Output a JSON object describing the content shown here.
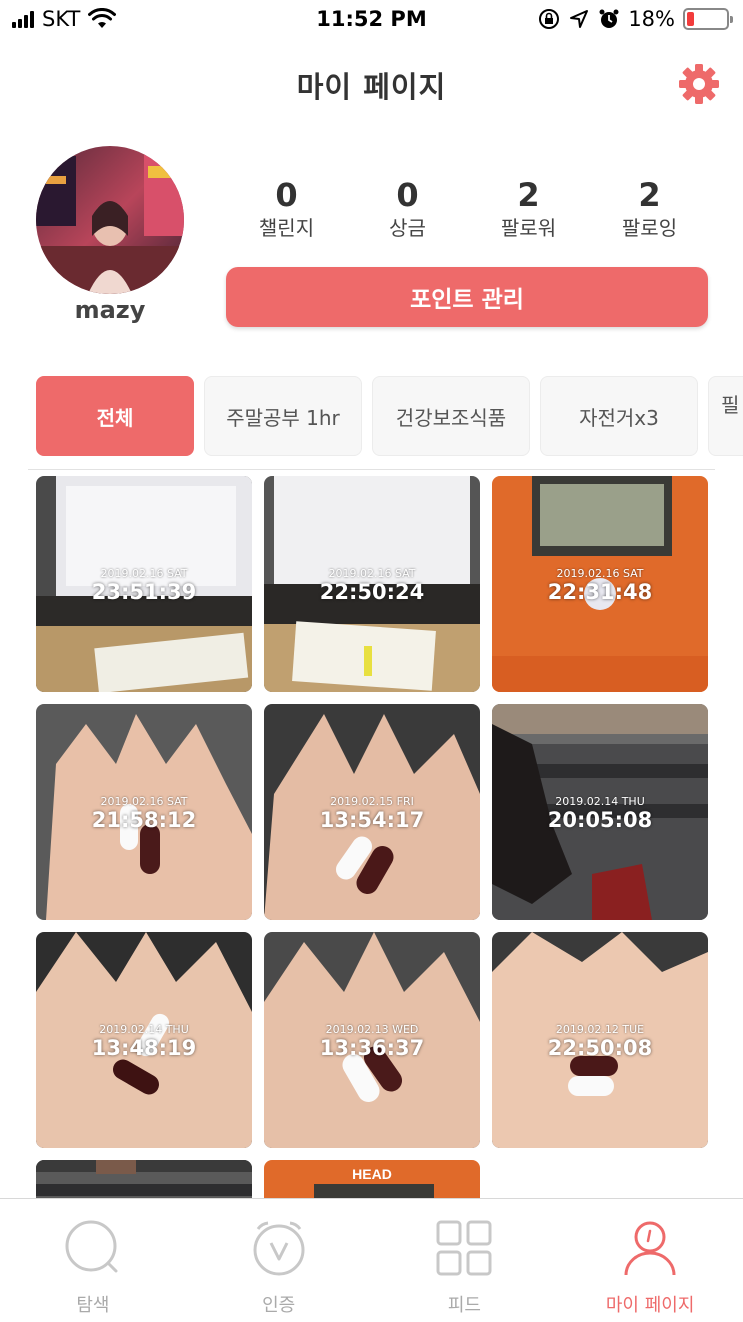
{
  "status_bar": {
    "carrier": "SKT",
    "time": "11:52 PM",
    "battery_pct": "18%",
    "battery_level": 0.18
  },
  "header": {
    "title": "마이 페이지",
    "settings_icon": "gear-icon"
  },
  "profile": {
    "username": "mazy",
    "stats": [
      {
        "value": "0",
        "label": "챌린지"
      },
      {
        "value": "0",
        "label": "상금"
      },
      {
        "value": "2",
        "label": "팔로워"
      },
      {
        "value": "2",
        "label": "팔로잉"
      }
    ],
    "point_button_label": "포인트 관리"
  },
  "tabs": [
    {
      "label": "전체",
      "active": true
    },
    {
      "label": "주말공부 1hr",
      "active": false
    },
    {
      "label": "건강보조식품",
      "active": false
    },
    {
      "label": "자전거x3",
      "active": false
    },
    {
      "label": "필",
      "active": false
    }
  ],
  "photos": [
    {
      "date": "2019.02.16 SAT",
      "time": "23:51:39",
      "scene": "desk"
    },
    {
      "date": "2019.02.16 SAT",
      "time": "22:50:24",
      "scene": "desk"
    },
    {
      "date": "2019.02.16 SAT",
      "time": "22:31:48",
      "scene": "clock"
    },
    {
      "date": "2019.02.16 SAT",
      "time": "21:58:12",
      "scene": "hand"
    },
    {
      "date": "2019.02.15 FRI",
      "time": "13:54:17",
      "scene": "hand"
    },
    {
      "date": "2019.02.14 THU",
      "time": "20:05:08",
      "scene": "gym"
    },
    {
      "date": "2019.02.14 THU",
      "time": "13:48:19",
      "scene": "hand"
    },
    {
      "date": "2019.02.13 WED",
      "time": "13:36:37",
      "scene": "hand"
    },
    {
      "date": "2019.02.12 TUE",
      "time": "22:50:08",
      "scene": "hand"
    },
    {
      "date": "",
      "time": "",
      "scene": "gym"
    },
    {
      "date": "",
      "time": "",
      "scene": "clock",
      "brand": "HEAD"
    }
  ],
  "bottom_nav": [
    {
      "label": "탐색",
      "icon": "search-icon",
      "active": false
    },
    {
      "label": "인증",
      "icon": "verify-icon",
      "active": false
    },
    {
      "label": "피드",
      "icon": "grid-icon",
      "active": false
    },
    {
      "label": "마이 페이지",
      "icon": "profile-icon",
      "active": true
    }
  ],
  "colors": {
    "accent": "#ee6a6a",
    "battery_low": "#f23c3c",
    "inactive": "#aaaaaa"
  }
}
